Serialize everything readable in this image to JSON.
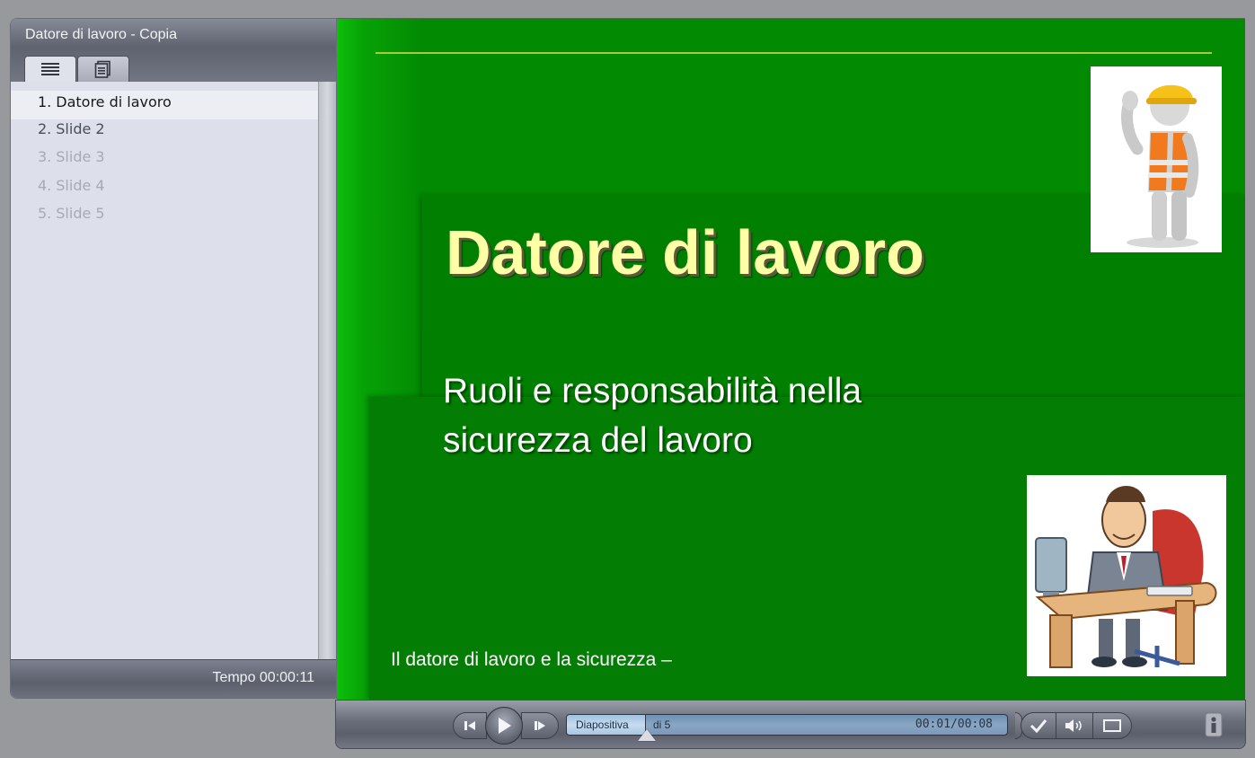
{
  "sidebar": {
    "title": "Datore di lavoro - Copia",
    "tabs": [
      {
        "name": "outline",
        "icon": "list-icon",
        "active": true
      },
      {
        "name": "notes",
        "icon": "notes-icon",
        "active": false
      }
    ],
    "slides": [
      {
        "number": "1.",
        "label": "Datore di lavoro",
        "state": "active"
      },
      {
        "number": "2.",
        "label": "Slide 2",
        "state": "enabled"
      },
      {
        "number": "3.",
        "label": "Slide 3",
        "state": "disabled"
      },
      {
        "number": "4.",
        "label": "Slide 4",
        "state": "disabled"
      },
      {
        "number": "5.",
        "label": "Slide 5",
        "state": "disabled"
      }
    ],
    "elapsed_time": "Tempo 00:00:11"
  },
  "slide": {
    "title": "Datore di lavoro",
    "subtitle": "Ruoli e responsabilità nella sicurezza del lavoro",
    "footer": "Il datore di lavoro e la sicurezza –",
    "images": [
      "worker-with-hard-hat-image",
      "manager-at-desk-image"
    ],
    "colors": {
      "background": "#038a03",
      "title": "#ffffa6",
      "rule": "#a6cc39"
    }
  },
  "player": {
    "slide_label": "Diapositiva",
    "slide_count": "di 5",
    "time": "00:01/00:08",
    "progress_fraction": 0.18,
    "buttons": [
      "prev-icon",
      "play-icon",
      "next-icon",
      "checkmark-icon",
      "volume-icon",
      "fullscreen-icon",
      "info-icon"
    ]
  }
}
